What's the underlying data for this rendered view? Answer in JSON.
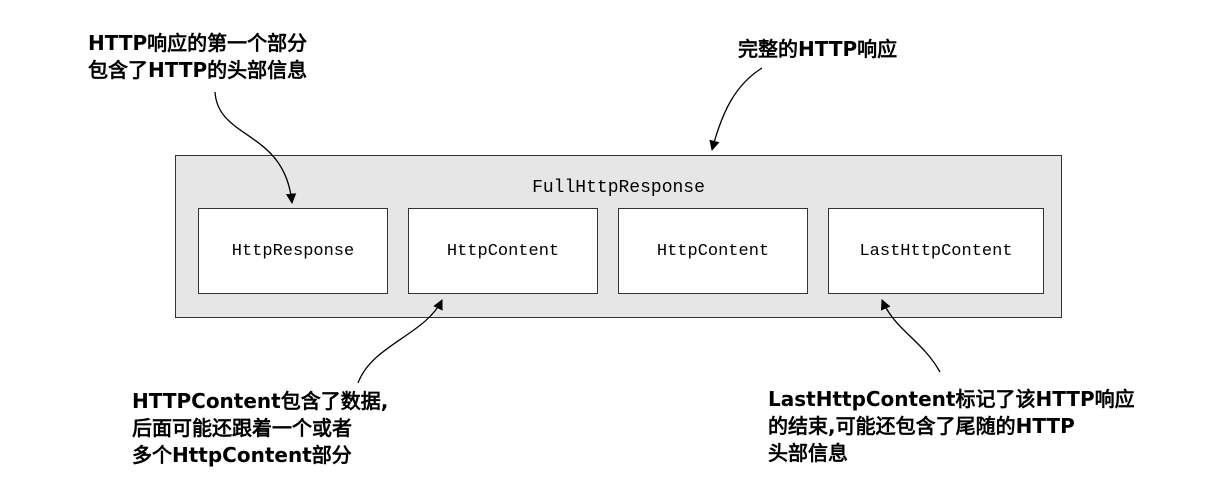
{
  "diagram": {
    "outer_label": "FullHttpResponse",
    "parts": [
      "HttpResponse",
      "HttpContent",
      "HttpContent",
      "LastHttpContent"
    ],
    "callouts": {
      "first_part": [
        "HTTP响应的第一个部分",
        "包含了HTTP的头部信息"
      ],
      "full_response": [
        "完整的HTTP响应"
      ],
      "content": [
        "HTTPContent包含了数据,",
        "后面可能还跟着一个或者",
        "多个HttpContent部分"
      ],
      "last_content": [
        "LastHttpContent标记了该HTTP响应",
        "的结束,可能还包含了尾随的HTTP",
        "头部信息"
      ]
    }
  }
}
